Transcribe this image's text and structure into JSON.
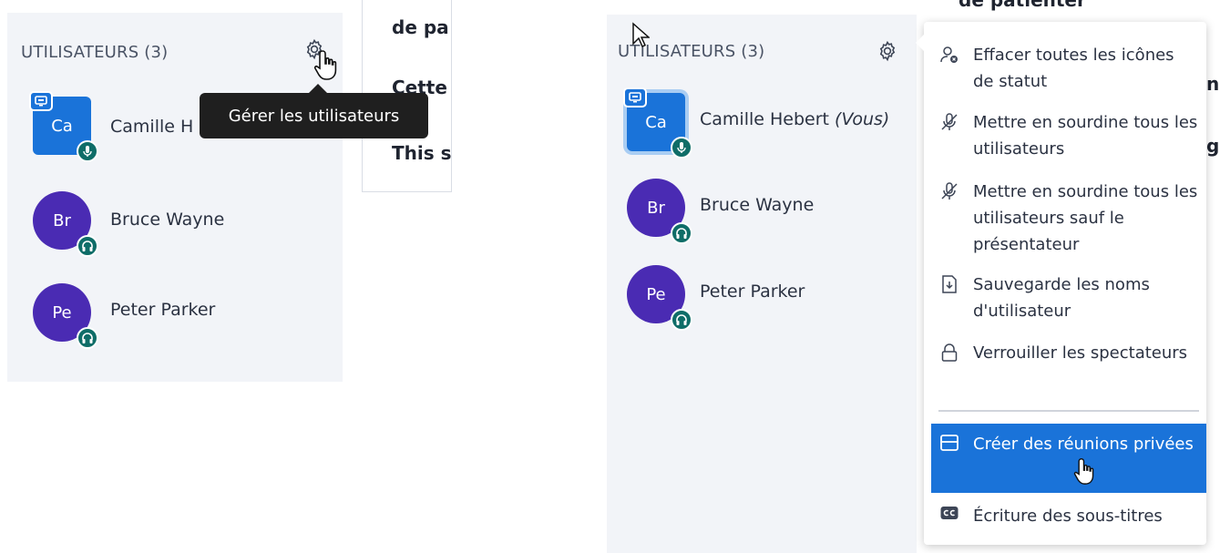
{
  "left_panel": {
    "title": "UTILISATEURS (3)",
    "tooltip": "Gérer les utilisateurs",
    "users": [
      {
        "initials": "Ca",
        "name": "Camille H"
      },
      {
        "initials": "Br",
        "name": "Bruce Wayne"
      },
      {
        "initials": "Pe",
        "name": "Peter Parker"
      }
    ]
  },
  "left_content": {
    "line1": "de pa",
    "line2": "Cette",
    "line3": "This s"
  },
  "right_panel": {
    "title": "UTILISATEURS (3)",
    "users": [
      {
        "initials": "Ca",
        "name": "Camille Hebert",
        "you_label": "(Vous)"
      },
      {
        "initials": "Br",
        "name": "Bruce Wayne"
      },
      {
        "initials": "Pe",
        "name": "Peter Parker"
      }
    ]
  },
  "right_content": {
    "line1": "de patienter",
    "fragment_n": "n",
    "fragment_g": "gl"
  },
  "menu": {
    "items": [
      {
        "icon": "clear-status-icon",
        "label": "Effacer toutes les icônes de statut"
      },
      {
        "icon": "mute-icon",
        "label": "Mettre en sourdine tous les utilisateurs"
      },
      {
        "icon": "mute-icon",
        "label": "Mettre en sourdine tous les utilisateurs sauf le présentateur"
      },
      {
        "icon": "download-icon",
        "label": "Sauvegarde les noms d'utilisateur"
      },
      {
        "icon": "lock-icon",
        "label": "Verrouiller les spectateurs"
      },
      {
        "icon": "breakout-room-icon",
        "label": "Créer des réunions privées"
      },
      {
        "icon": "closed-caption-icon",
        "label": "Écriture des sous-titres"
      }
    ]
  },
  "colors": {
    "panel_bg": "#f2f4f8",
    "presenter_avatar": "#1a73d9",
    "viewer_avatar": "#4a2bb3",
    "status_badge": "#0f6d68",
    "menu_highlight": "#1a73d9",
    "tooltip_bg": "#1f1f1f"
  }
}
